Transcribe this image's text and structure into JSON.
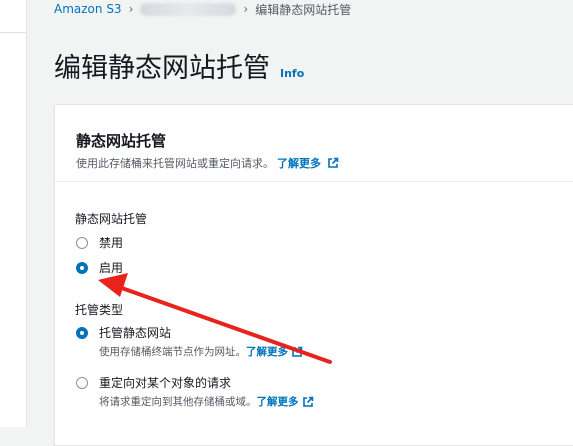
{
  "breadcrumb": {
    "root": "Amazon S3",
    "current": "编辑静态网站托管"
  },
  "page": {
    "title": "编辑静态网站托管",
    "info": "Info"
  },
  "panel": {
    "title": "静态网站托管",
    "description": "使用此存储桶来托管网站或重定向请求。",
    "learn_more": "了解更多"
  },
  "hosting": {
    "label": "静态网站托管",
    "options": [
      {
        "label": "禁用",
        "checked": false
      },
      {
        "label": "启用",
        "checked": true
      }
    ]
  },
  "hosting_type": {
    "label": "托管类型",
    "options": [
      {
        "label": "托管静态网站",
        "description": "使用存储桶终端节点作为网址。",
        "learn_more": "了解更多",
        "checked": true
      },
      {
        "label": "重定向对某个对象的请求",
        "description": "将请求重定向到其他存储桶或域。",
        "learn_more": "了解更多",
        "checked": false
      }
    ]
  },
  "colors": {
    "accent": "#0073bb",
    "annotation_arrow": "#e8231b"
  },
  "icons": [
    "chevron-right-icon",
    "external-link-icon",
    "radio-icon",
    "annotation-arrow"
  ]
}
